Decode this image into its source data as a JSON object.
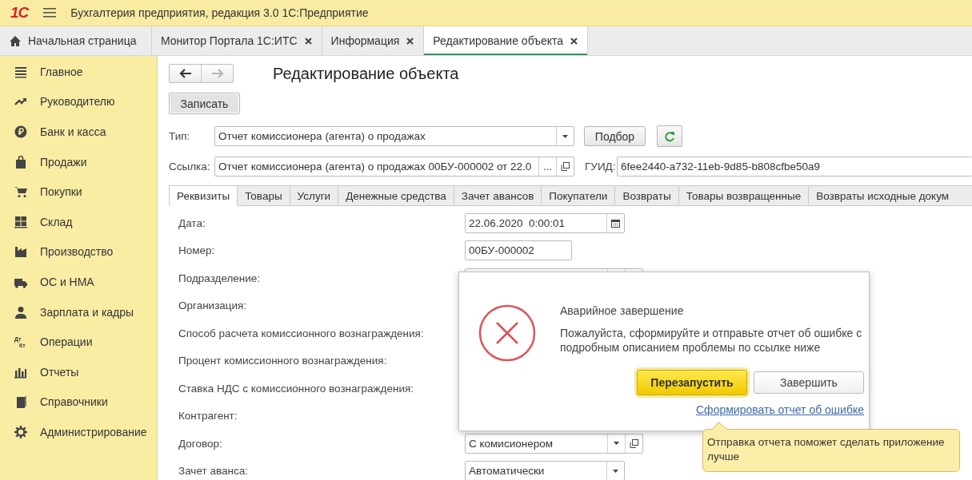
{
  "app": {
    "logo": "1С",
    "title": "Бухгалтерия предприятия, редакция 3.0 1С:Предприятие"
  },
  "tabs": [
    {
      "label": "Начальная страница",
      "kind": "home",
      "selected": false
    },
    {
      "label": "Монитор Портала 1С:ИТС",
      "kind": "closable",
      "selected": false
    },
    {
      "label": "Информация",
      "kind": "closable",
      "selected": false
    },
    {
      "label": "Редактирование объекта",
      "kind": "closable",
      "selected": true
    }
  ],
  "sidebar": {
    "items": [
      {
        "label": "Главное"
      },
      {
        "label": "Руководителю"
      },
      {
        "label": "Банк и касса"
      },
      {
        "label": "Продажи"
      },
      {
        "label": "Покупки"
      },
      {
        "label": "Склад"
      },
      {
        "label": "Производство"
      },
      {
        "label": "ОС и НМА"
      },
      {
        "label": "Зарплата и кадры"
      },
      {
        "label": "Операции",
        "icon_texts": [
          "Дт",
          "Кт"
        ]
      },
      {
        "label": "Отчеты"
      },
      {
        "label": "Справочники"
      },
      {
        "label": "Администрирование"
      }
    ]
  },
  "form": {
    "nav": [
      {
        "kind": "back",
        "disabled": false
      },
      {
        "kind": "forward",
        "disabled": true
      }
    ],
    "title": "Редактирование объекта",
    "save_button": "Записать",
    "type": {
      "label": "Тип:",
      "value": "Отчет комиссионера (агента) о продажах",
      "pick_button": "Подбор"
    },
    "link": {
      "label": "Ссылка:",
      "value": "Отчет комиссионера (агента) о продажах 00БУ-000002 от 22.0",
      "more_button": "...",
      "guid_label": "ГУИД:",
      "guid": "6fee2440-a732-11eb-9d85-b808cfbe50a9"
    },
    "tabs": [
      {
        "label": "Реквизиты",
        "selected": true
      },
      {
        "label": "Товары",
        "selected": false
      },
      {
        "label": "Услуги",
        "selected": false
      },
      {
        "label": "Денежные средства",
        "selected": false
      },
      {
        "label": "Зачет авансов",
        "selected": false
      },
      {
        "label": "Покупатели",
        "selected": false
      },
      {
        "label": "Возвраты",
        "selected": false
      },
      {
        "label": "Товары возвращенные",
        "selected": false
      },
      {
        "label": "Возвраты исходные докум",
        "selected": false
      }
    ],
    "rows": [
      {
        "label": "Дата:",
        "field": {
          "kind": "date",
          "value": "22.06.2020  0:00:01"
        }
      },
      {
        "label": "Номер:",
        "field": {
          "kind": "text",
          "value": "00БУ-000002"
        }
      },
      {
        "label": "Подразделение:",
        "field": {
          "kind": "select_open"
        }
      },
      {
        "label": "Организация:"
      },
      {
        "label": "Способ расчета комиссионного вознаграждения:"
      },
      {
        "label": "Процент комиссионного вознаграждения:"
      },
      {
        "label": "Ставка НДС с комиссионного вознаграждения:"
      },
      {
        "label": "Контрагент:"
      },
      {
        "label": "Договор:",
        "field": {
          "kind": "select_open",
          "value": "С комисионером"
        }
      },
      {
        "label": "Зачет аванса:",
        "field": {
          "kind": "select",
          "value": "Автоматически"
        }
      }
    ]
  },
  "dialog": {
    "title": "Аварийное завершение",
    "message": "Пожалуйста, сформируйте и отправьте отчет об ошибке с подробным описанием проблемы по ссылке ниже",
    "restart_button": "Перезапустить",
    "finish_button": "Завершить",
    "report_link": "Сформировать отчет об ошибке",
    "tooltip": "Отправка отчета поможет сделать приложение лучше"
  }
}
